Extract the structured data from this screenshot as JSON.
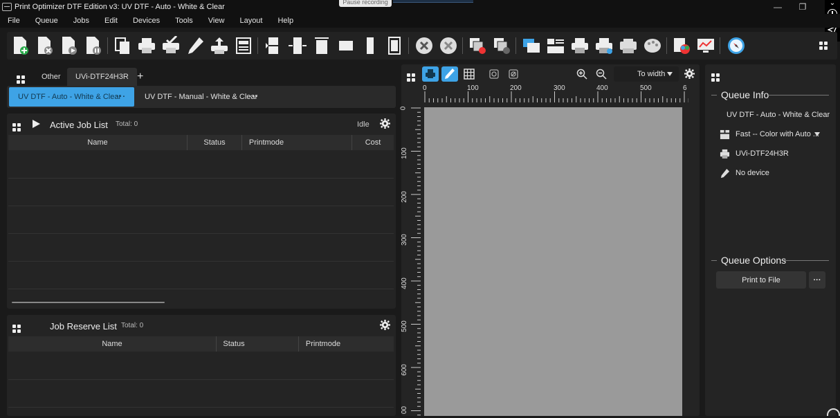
{
  "window": {
    "title": "Print Optimizer DTF Edition v3: UV DTF - Auto - White & Clear",
    "recording_tooltip": "Pause recording"
  },
  "menu": [
    "File",
    "Queue",
    "Jobs",
    "Edit",
    "Devices",
    "Tools",
    "View",
    "Layout",
    "Help"
  ],
  "queue_tabs": {
    "other_label": "Other",
    "printer_label": "UVi-DTF24H3R"
  },
  "queues": [
    {
      "label": "UV DTF - Auto - White & Clear",
      "selected": true
    },
    {
      "label": "UV DTF - Manual - White & Clear",
      "selected": false
    }
  ],
  "active_jobs": {
    "title": "Active Job List",
    "total": "Total: 0",
    "status": "Idle",
    "columns": [
      "Name",
      "Status",
      "Printmode",
      "Cost"
    ]
  },
  "reserve_jobs": {
    "title": "Job Reserve List",
    "total": "Total: 0",
    "columns": [
      "Name",
      "Status",
      "Printmode"
    ]
  },
  "preview": {
    "zoom_mode": "To width",
    "ruler_h_ticks": [
      "0",
      "100",
      "200",
      "300",
      "400",
      "500",
      "6"
    ],
    "ruler_v_ticks": [
      "0",
      "100",
      "200",
      "300",
      "400",
      "500",
      "600",
      "00"
    ]
  },
  "queue_info": {
    "heading": "Queue Info",
    "queue_name": "UV DTF - Auto - White & Clear",
    "printmode": "Fast -- Color with Auto ...",
    "printer": "UVi-DTF24H3R",
    "device": "No device"
  },
  "queue_options": {
    "heading": "Queue Options",
    "print_to_file": "Print to File"
  },
  "colors": {
    "accent": "#3ea3e6",
    "background": "#1a1a1a",
    "panel": "#242424",
    "canvas": "#9a9a9a"
  }
}
